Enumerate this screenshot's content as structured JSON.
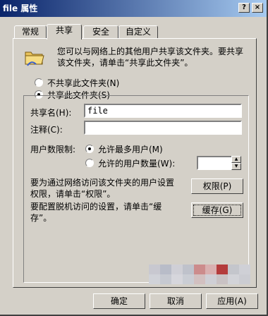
{
  "window": {
    "title": "file 属性",
    "help_label": "?",
    "close_label": "×"
  },
  "tabs": [
    {
      "label": "常规"
    },
    {
      "label": "共享"
    },
    {
      "label": "安全"
    },
    {
      "label": "自定义"
    }
  ],
  "share": {
    "description": [
      "您可以与网络上的其他用户共享该文件夹。要共享",
      "该文件夹，请单击“共享此文件夹”。"
    ],
    "no_share_label": "不共享此文件夹(N)",
    "share_label": "共享此文件夹(S)",
    "share_name_label": "共享名(H):",
    "share_name_value": "file",
    "comment_label": "注释(C):",
    "comment_value": "",
    "user_limit_label": "用户数限制:",
    "max_users_label": "允许最多用户(M)",
    "allowed_users_label": "允许的用户数量(W):",
    "permissions_desc": [
      "要为通过网络访问该文件夹的用户设置",
      "权限，请单击“权限”。"
    ],
    "permissions_button": "权限(P)",
    "caching_desc": [
      "要配置脱机访问的设置，请单击“缓",
      "存”。"
    ],
    "caching_button": "缓存(G)"
  },
  "footer": {
    "ok": "确定",
    "cancel": "取消",
    "apply": "应用(A)"
  },
  "colors": {
    "titlebar_start": "#0a246a",
    "titlebar_end": "#a6caf0",
    "face": "#d4d0c8",
    "backdrop": "#8c0a0a"
  },
  "icons": {
    "folder": "shared-folder-icon"
  }
}
